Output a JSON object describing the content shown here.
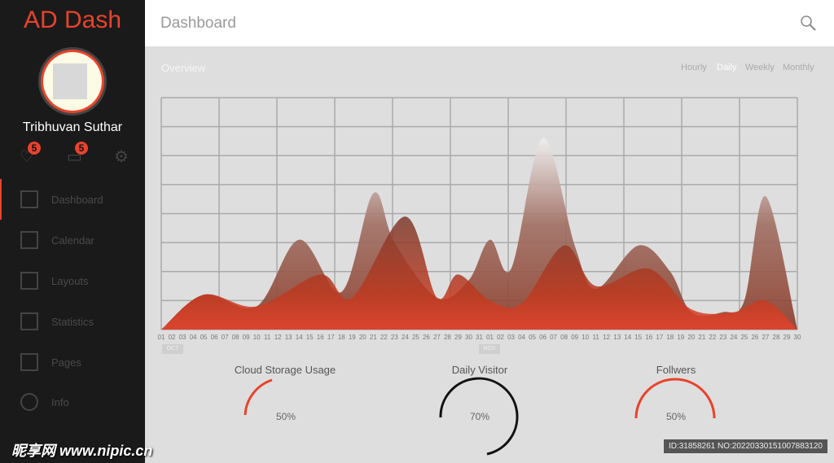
{
  "brand": "AD Dash",
  "user": {
    "name": "Tribhuvan Suthar",
    "likes_badge": "5",
    "messages_badge": "5"
  },
  "nav": [
    {
      "label": "Dashboard",
      "icon": "dashboard-grid-icon"
    },
    {
      "label": "Calendar",
      "icon": "calendar-icon"
    },
    {
      "label": "Layouts",
      "icon": "layouts-icon"
    },
    {
      "label": "Statistics",
      "icon": "statistics-icon"
    },
    {
      "label": "Pages",
      "icon": "pages-icon"
    },
    {
      "label": "Info",
      "icon": "info-icon"
    }
  ],
  "header": {
    "title": "Dashboard"
  },
  "overview": {
    "title": "Overview",
    "periods": [
      "Hourly",
      "Daily",
      "Weekly",
      "Monthly"
    ],
    "selected": "Daily"
  },
  "colors": {
    "accent": "#e8432c",
    "sidebar": "#1a1a1a"
  },
  "chart_data": {
    "type": "area",
    "grid": true,
    "ylim": [
      0,
      8
    ],
    "months": [
      "OCT",
      "NOV"
    ],
    "x": [
      "01",
      "02",
      "03",
      "04",
      "05",
      "06",
      "07",
      "08",
      "09",
      "10",
      "11",
      "12",
      "13",
      "14",
      "15",
      "16",
      "17",
      "18",
      "19",
      "20",
      "21",
      "22",
      "23",
      "24",
      "25",
      "26",
      "27",
      "28",
      "29",
      "30",
      "31",
      "01",
      "02",
      "03",
      "04",
      "05",
      "06",
      "07",
      "08",
      "09",
      "10",
      "11",
      "12",
      "13",
      "14",
      "15",
      "16",
      "17",
      "18",
      "19",
      "20",
      "21",
      "22",
      "23",
      "24",
      "25",
      "26",
      "27",
      "28",
      "29",
      "30"
    ],
    "series": [
      {
        "key": [
          [
            1,
            0
          ],
          [
            5,
            1.2
          ],
          [
            10,
            0.8
          ],
          [
            14,
            3.1
          ],
          [
            18,
            1.3
          ],
          [
            21,
            4.7
          ],
          [
            23,
            3.0
          ],
          [
            27,
            1.1
          ],
          [
            30,
            1.7
          ],
          [
            32,
            3.1
          ],
          [
            34,
            2.1
          ],
          [
            37,
            6.6
          ],
          [
            40,
            2.9
          ],
          [
            42,
            1.4
          ],
          [
            46,
            2.9
          ],
          [
            49,
            2.0
          ],
          [
            51,
            0.6
          ],
          [
            54,
            0.6
          ],
          [
            56,
            1.0
          ],
          [
            58,
            4.6
          ],
          [
            61,
            0
          ]
        ]
      },
      {
        "key": [
          [
            1,
            0
          ],
          [
            5,
            1.2
          ],
          [
            10,
            0.8
          ],
          [
            16,
            1.9
          ],
          [
            19,
            1.1
          ],
          [
            24,
            3.9
          ],
          [
            27,
            1.1
          ],
          [
            29,
            1.9
          ],
          [
            32,
            1.0
          ],
          [
            35,
            0.9
          ],
          [
            39,
            2.9
          ],
          [
            42,
            1.5
          ],
          [
            47,
            2.1
          ],
          [
            51,
            0.7
          ],
          [
            55,
            0.6
          ],
          [
            58,
            1.0
          ],
          [
            61,
            0
          ]
        ]
      }
    ]
  },
  "gauges": [
    {
      "title": "Cloud Storage Usage",
      "value": "50%"
    },
    {
      "title": "Daily Visitor",
      "value": "70%"
    },
    {
      "title": "Follwers",
      "value": "50%"
    }
  ],
  "watermark": "昵享网 www.nipic.cn",
  "image_id": "ID:31858261 NO:20220330151007883120"
}
